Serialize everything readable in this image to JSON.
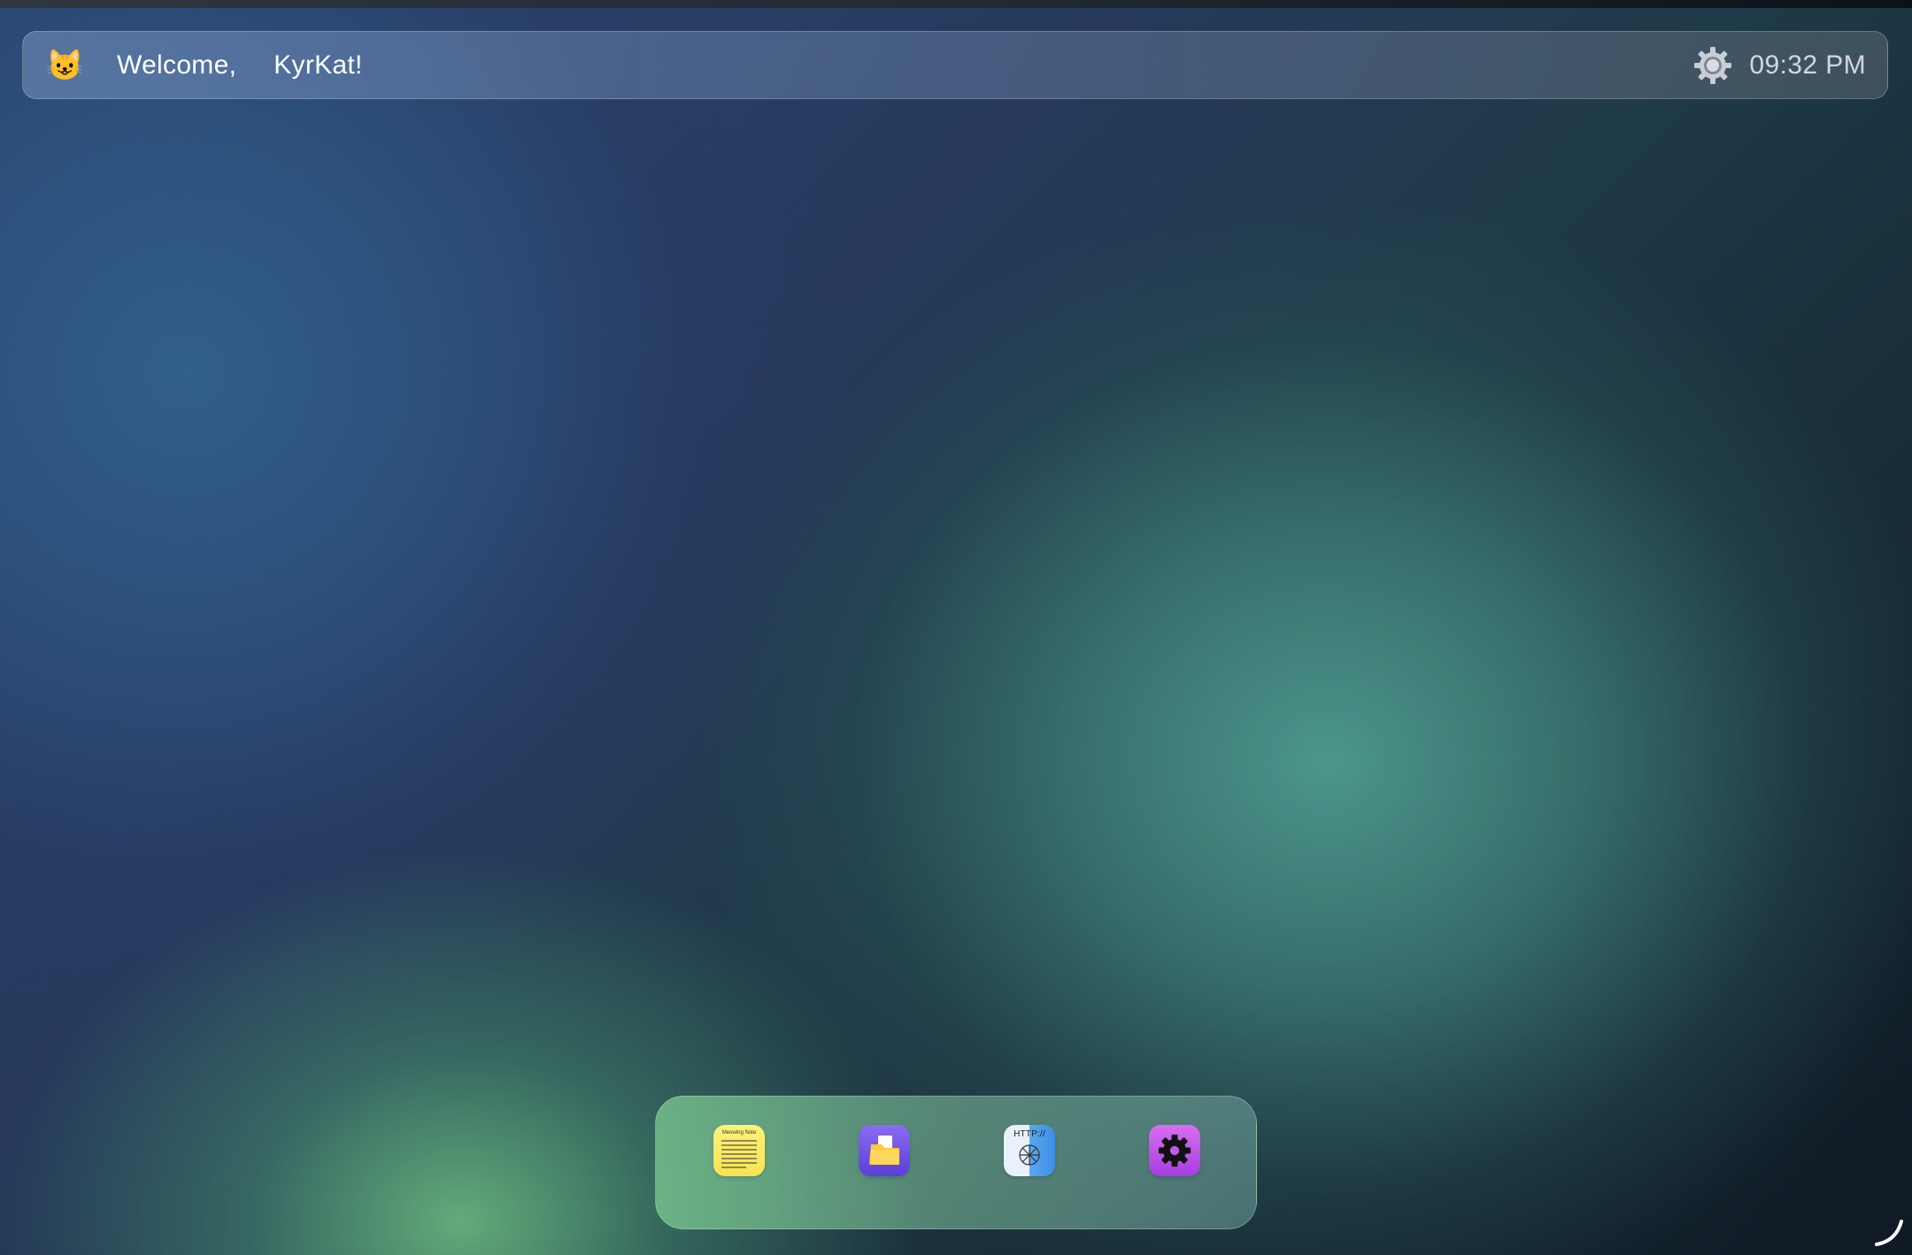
{
  "topbar": {
    "avatar_emoji": "😺",
    "welcome_text": "Welcome,",
    "username": "KyrKat!",
    "clock": "09:32 PM",
    "settings_icon": "gear-icon"
  },
  "dock": {
    "items": [
      {
        "app": "notes",
        "icon": "sticky-note-icon",
        "icon_caption": "Meowing Note",
        "color": "#f7e252"
      },
      {
        "app": "files",
        "icon": "folder-icon",
        "color": "#6a4ee0"
      },
      {
        "app": "browser",
        "icon": "globe-icon",
        "icon_caption": "HTTP://",
        "color": "#4a9ced"
      },
      {
        "app": "settings",
        "icon": "gear-icon",
        "color": "#b84ee6"
      }
    ]
  },
  "colors": {
    "accent_blue": "#2c4a75",
    "accent_teal": "#4c968c",
    "accent_green": "#6ebe82"
  }
}
